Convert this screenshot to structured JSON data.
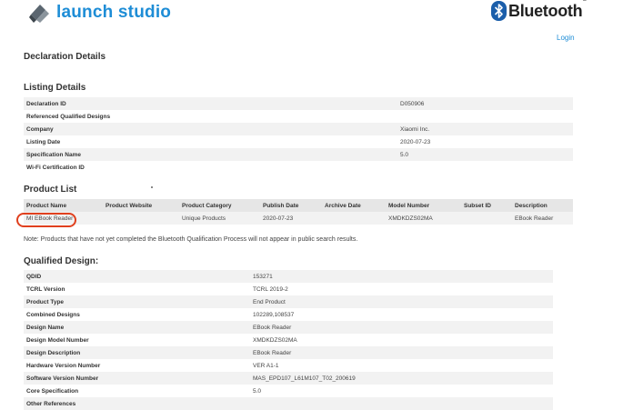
{
  "header": {
    "logo_text": "launch studio",
    "brand_text": "Bluetooth",
    "brand_tm": "®",
    "login_label": "Login"
  },
  "colors": {
    "accent": "#1e8dd6",
    "highlight": "#e0401e",
    "row_alt": "#f2f2f2",
    "header_row": "#e6e6e6"
  },
  "declaration": {
    "title": "Declaration Details"
  },
  "listing": {
    "title": "Listing Details",
    "rows": [
      {
        "label": "Declaration ID",
        "value": "D050906"
      },
      {
        "label": "Referenced Qualified Designs",
        "value": ""
      },
      {
        "label": "Company",
        "value": "Xiaomi Inc."
      },
      {
        "label": "Listing Date",
        "value": "2020-07-23"
      },
      {
        "label": "Specification Name",
        "value": "5.0"
      },
      {
        "label": "Wi-Fi Certification ID",
        "value": ""
      }
    ]
  },
  "product_list": {
    "title": "Product List",
    "columns": [
      "Product Name",
      "Product Website",
      "Product Category",
      "Publish Date",
      "Archive Date",
      "Model Number",
      "Subset ID",
      "Description"
    ],
    "rows": [
      [
        "MI EBook Reader",
        "",
        "Unique Products",
        "2020-07-23",
        "",
        "XMDKDZS02MA",
        "",
        "EBook Reader"
      ]
    ],
    "note": "Note: Products that have not yet completed the Bluetooth Qualification Process will not appear in public search results."
  },
  "qualified": {
    "title": "Qualified Design:",
    "rows": [
      {
        "label": "QDID",
        "value": "153271"
      },
      {
        "label": "TCRL Version",
        "value": "TCRL 2019-2"
      },
      {
        "label": "Product Type",
        "value": "End Product"
      },
      {
        "label": "Combined Designs",
        "value": "102289,108537"
      },
      {
        "label": "Design Name",
        "value": "EBook Reader"
      },
      {
        "label": "Design Model Number",
        "value": "XMDKDZS02MA"
      },
      {
        "label": "Design Description",
        "value": "EBook Reader"
      },
      {
        "label": "Hardware Version Number",
        "value": "VER A1-1"
      },
      {
        "label": "Software Version Number",
        "value": "MAS_EPD107_L61M107_T02_200619"
      },
      {
        "label": "Core Specification",
        "value": "5.0"
      },
      {
        "label": "Other References",
        "value": ""
      }
    ]
  }
}
